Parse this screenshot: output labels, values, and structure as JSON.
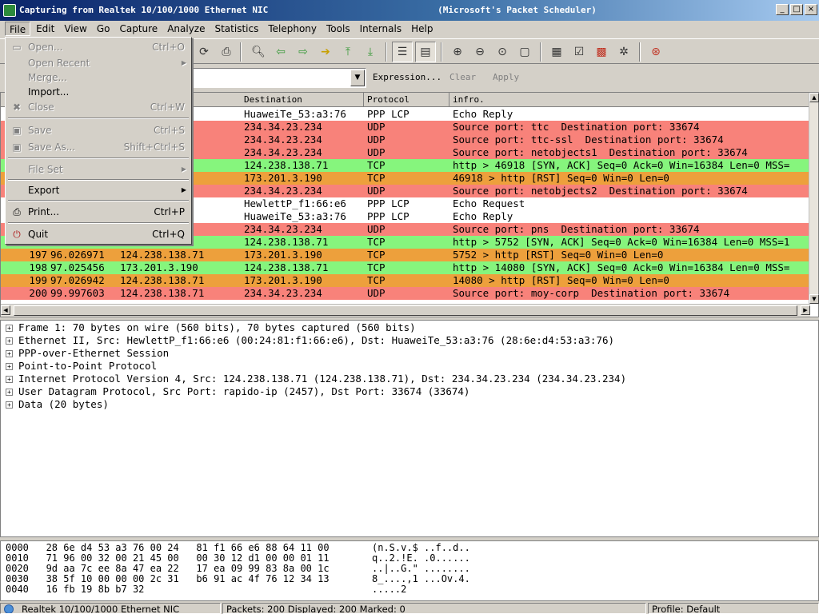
{
  "window": {
    "title": "Capturing from Realtek 10/100/1000 Ethernet NIC                                (Microsoft's Packet Scheduler)",
    "controls": [
      "_",
      "□",
      "×"
    ]
  },
  "menubar": [
    "File",
    "Edit",
    "View",
    "Go",
    "Capture",
    "Analyze",
    "Statistics",
    "Telephony",
    "Tools",
    "Internals",
    "Help"
  ],
  "filter": {
    "value": "",
    "expression_label": "Expression...",
    "clear_label": "Clear",
    "apply_label": "Apply"
  },
  "packet_list": {
    "columns": [
      "Destination",
      "Protocol",
      "infro."
    ],
    "rows": [
      {
        "no": "",
        "time": "",
        "src": ":66:e6",
        "dst": "HuaweiTe_53:a3:76",
        "proto": "PPP LCP",
        "info": "Echo Reply",
        "color": "#ffffff"
      },
      {
        "no": "",
        "time": "",
        "src": ".71",
        "dst": "234.34.23.234",
        "proto": "UDP",
        "info": "Source port: ttc  Destination port: 33674",
        "color": "#f8827a"
      },
      {
        "no": "",
        "time": "",
        "src": ".71",
        "dst": "234.34.23.234",
        "proto": "UDP",
        "info": "Source port: ttc-ssl  Destination port: 33674",
        "color": "#f8827a"
      },
      {
        "no": "",
        "time": "",
        "src": ".71",
        "dst": "234.34.23.234",
        "proto": "UDP",
        "info": "Source port: netobjects1  Destination port: 33674",
        "color": "#f8827a"
      },
      {
        "no": "",
        "time": "",
        "src": "90",
        "dst": "124.238.138.71",
        "proto": "TCP",
        "info": "http > 46918 [SYN, ACK] Seq=0 Ack=0 Win=16384 Len=0 MSS=",
        "color": "#86f57d"
      },
      {
        "no": "",
        "time": "",
        "src": ".71",
        "dst": "173.201.3.190",
        "proto": "TCP",
        "info": "46918 > http [RST] Seq=0 Win=0 Len=0",
        "color": "#eda03c"
      },
      {
        "no": "",
        "time": "",
        "src": ".71",
        "dst": "234.34.23.234",
        "proto": "UDP",
        "info": "Source port: netobjects2  Destination port: 33674",
        "color": "#f8827a"
      },
      {
        "no": "",
        "time": "",
        "src": "a3:76",
        "dst": "HewlettP_f1:66:e6",
        "proto": "PPP LCP",
        "info": "Echo Request",
        "color": "#ffffff"
      },
      {
        "no": "",
        "time": "",
        "src": ":66:e6",
        "dst": "HuaweiTe_53:a3:76",
        "proto": "PPP LCP",
        "info": "Echo Reply",
        "color": "#ffffff"
      },
      {
        "no": "",
        "time": "",
        "src": ".71",
        "dst": "234.34.23.234",
        "proto": "UDP",
        "info": "Source port: pns  Destination port: 33674",
        "color": "#f8827a"
      },
      {
        "no": "",
        "time": "",
        "src": "90",
        "dst": "124.238.138.71",
        "proto": "TCP",
        "info": "http > 5752 [SYN, ACK] Seq=0 Ack=0 Win=16384 Len=0 MSS=1",
        "color": "#86f57d"
      },
      {
        "no": "197",
        "time": "96.026971",
        "src": "124.238.138.71",
        "dst": "173.201.3.190",
        "proto": "TCP",
        "info": "5752 > http [RST] Seq=0 Win=0 Len=0",
        "color": "#eda03c"
      },
      {
        "no": "198",
        "time": "97.025456",
        "src": "173.201.3.190",
        "dst": "124.238.138.71",
        "proto": "TCP",
        "info": "http > 14080 [SYN, ACK] Seq=0 Ack=0 Win=16384 Len=0 MSS=",
        "color": "#86f57d"
      },
      {
        "no": "199",
        "time": "97.026942",
        "src": "124.238.138.71",
        "dst": "173.201.3.190",
        "proto": "TCP",
        "info": "14080 > http [RST] Seq=0 Win=0 Len=0",
        "color": "#eda03c"
      },
      {
        "no": "200",
        "time": "99.997603",
        "src": "124.238.138.71",
        "dst": "234.34.23.234",
        "proto": "UDP",
        "info": "Source port: moy-corp  Destination port: 33674",
        "color": "#f8827a"
      }
    ]
  },
  "details": [
    "Frame 1: 70 bytes on wire (560 bits), 70 bytes captured (560 bits)",
    "Ethernet II, Src: HewlettP_f1:66:e6 (00:24:81:f1:66:e6), Dst: HuaweiTe_53:a3:76 (28:6e:d4:53:a3:76)",
    "PPP-over-Ethernet Session",
    "Point-to-Point Protocol",
    "Internet Protocol Version 4, Src: 124.238.138.71 (124.238.138.71), Dst: 234.34.23.234 (234.34.23.234)",
    "User Datagram Protocol, Src Port: rapido-ip (2457), Dst Port: 33674 (33674)",
    "Data (20 bytes)"
  ],
  "hex": [
    {
      "hex": "0000   28 6e d4 53 a3 76 00 24   81 f1 66 e6 88 64 11 00",
      "ascii": "(n.S.v.$ ..f..d.."
    },
    {
      "hex": "0010   71 96 00 32 00 21 45 00   00 30 12 d1 00 00 01 11",
      "ascii": "q..2.!E. .0......"
    },
    {
      "hex": "0020   9d aa 7c ee 8a 47 ea 22   17 ea 09 99 83 8a 00 1c",
      "ascii": "..|..G.\" ........"
    },
    {
      "hex": "0030   38 5f 10 00 00 00 2c 31   b6 91 ac 4f 76 12 34 13",
      "ascii": "8_....,1 ...Ov.4."
    },
    {
      "hex": "0040   16 fb 19 8b b7 32",
      "ascii": ".....2"
    }
  ],
  "status": {
    "interface": "Realtek 10/100/1000 Ethernet NIC",
    "packets": "Packets: 200 Displayed: 200 Marked: 0",
    "profile": "Profile: Default"
  },
  "file_menu": {
    "items": [
      {
        "label": "Open...",
        "accel": "Ctrl+O",
        "icon": "folder-icon",
        "enabled": false
      },
      {
        "label": "Open Recent",
        "accel": "",
        "icon": "",
        "enabled": false,
        "submenu": true
      },
      {
        "label": "Merge...",
        "accel": "",
        "icon": "",
        "enabled": false
      },
      {
        "label": "Import...",
        "accel": "",
        "icon": "",
        "enabled": true
      },
      {
        "label": "Close",
        "accel": "Ctrl+W",
        "icon": "close-icon",
        "enabled": false
      },
      {
        "label": "Save",
        "accel": "Ctrl+S",
        "icon": "save-icon",
        "enabled": false
      },
      {
        "label": "Save As...",
        "accel": "Shift+Ctrl+S",
        "icon": "save-as-icon",
        "enabled": false
      },
      {
        "label": "File Set",
        "accel": "",
        "icon": "",
        "enabled": false,
        "submenu": true
      },
      {
        "label": "Export",
        "accel": "",
        "icon": "",
        "enabled": true,
        "submenu": true
      },
      {
        "label": "Print...",
        "accel": "Ctrl+P",
        "icon": "print-icon",
        "enabled": true
      },
      {
        "label": "Quit",
        "accel": "Ctrl+Q",
        "icon": "quit-icon",
        "enabled": true
      }
    ]
  }
}
